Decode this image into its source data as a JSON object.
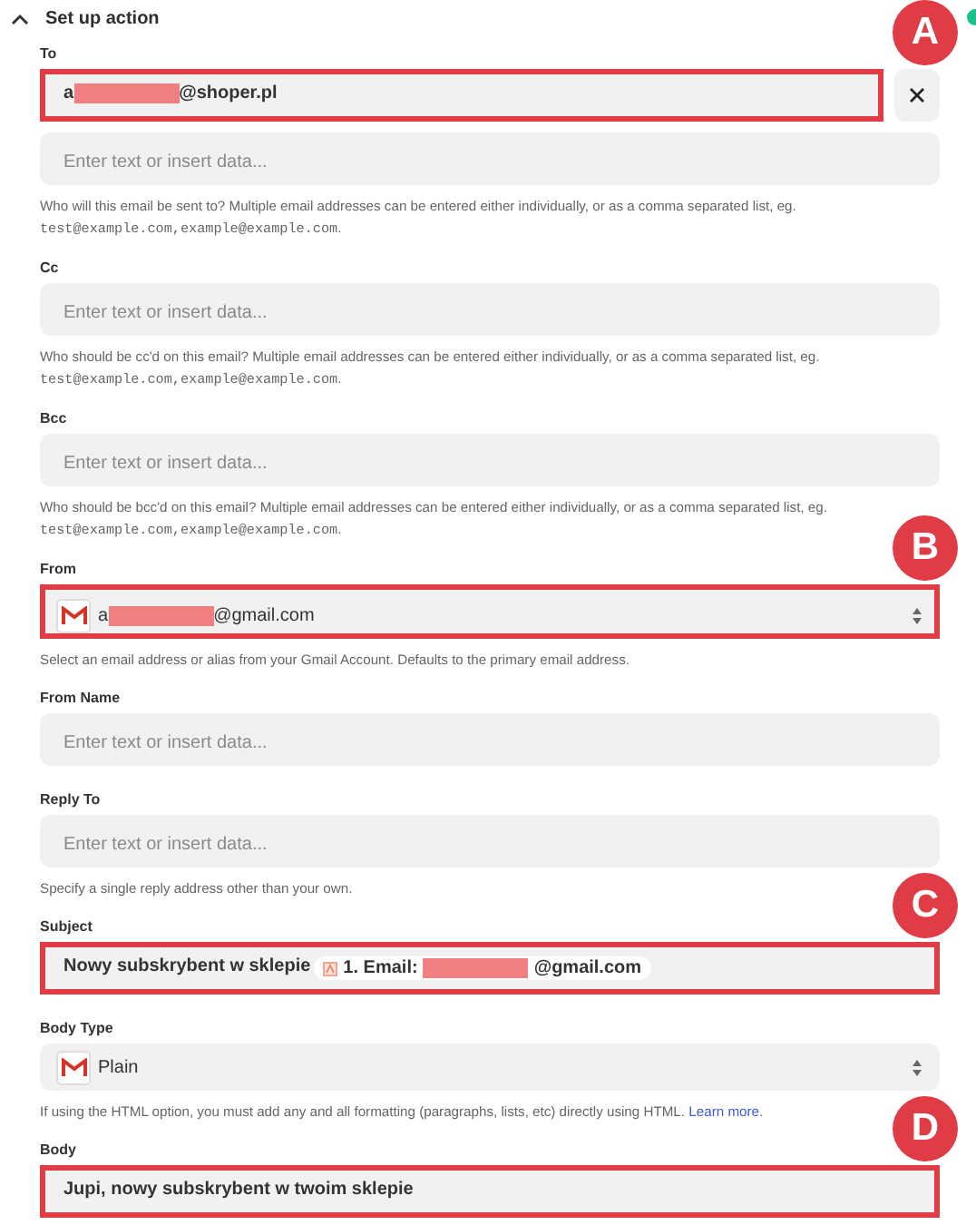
{
  "section": {
    "title": "Set up action",
    "expanded": true
  },
  "fields": [
    {
      "label": "To",
      "callout": "A",
      "inputs": [
        {
          "kind": "text",
          "highlighted": true,
          "removable": true,
          "parts": [
            {
              "kind": "text",
              "text": "a"
            },
            {
              "kind": "redacted"
            },
            {
              "kind": "text",
              "text": "@shoper.pl"
            }
          ]
        },
        {
          "kind": "text",
          "highlighted": false,
          "removable": false,
          "placeholder": "Enter text or insert data..."
        }
      ],
      "help": {
        "text": "Who will this email be sent to? Multiple email addresses can be entered either individually, or as a comma separated list, eg.",
        "code": "test@example.com,example@example.com",
        "end": "."
      }
    },
    {
      "label": "Cc",
      "inputs": [
        {
          "kind": "text",
          "highlighted": false,
          "removable": false,
          "placeholder": "Enter text or insert data..."
        }
      ],
      "help": {
        "text": "Who should be cc'd on this email? Multiple email addresses can be entered either individually, or as a comma separated list, eg.",
        "code": "test@example.com,example@example.com",
        "end": "."
      }
    },
    {
      "label": "Bcc",
      "inputs": [
        {
          "kind": "text",
          "highlighted": false,
          "removable": false,
          "placeholder": "Enter text or insert data..."
        }
      ],
      "help": {
        "text": "Who should be bcc'd on this email? Multiple email addresses can be entered either individually, or as a comma separated list, eg.",
        "code": "test@example.com,example@example.com",
        "end": "."
      }
    },
    {
      "label": "From",
      "callout": "B",
      "inputs": [
        {
          "kind": "select",
          "highlighted": true,
          "parts": [
            {
              "kind": "text",
              "text": "a"
            },
            {
              "kind": "redacted"
            },
            {
              "kind": "text",
              "text": "@gmail.com"
            }
          ]
        }
      ],
      "help": {
        "text": "Select an email address or alias from your Gmail Account. Defaults to the primary email address."
      }
    },
    {
      "label": "From Name",
      "inputs": [
        {
          "kind": "text",
          "highlighted": false,
          "removable": false,
          "placeholder": "Enter text or insert data..."
        }
      ]
    },
    {
      "label": "Reply To",
      "inputs": [
        {
          "kind": "text",
          "highlighted": false,
          "removable": false,
          "placeholder": "Enter text or insert data..."
        }
      ],
      "help": {
        "text": "Specify a single reply address other than your own."
      }
    },
    {
      "label": "Subject",
      "callout": "C",
      "inputs": [
        {
          "kind": "text",
          "highlighted": true,
          "removable": false,
          "parts": [
            {
              "kind": "text",
              "text": "Nowy subskrybent w sklepie"
            },
            {
              "kind": "token",
              "label": "1. Email:",
              "parts": [
                {
                  "kind": "redacted"
                },
                {
                  "kind": "text",
                  "text": "@gmail.com"
                }
              ]
            }
          ]
        }
      ]
    },
    {
      "label": "Body Type",
      "inputs": [
        {
          "kind": "select",
          "highlighted": false,
          "parts": [
            {
              "kind": "text",
              "text": "Plain"
            }
          ]
        }
      ],
      "help": {
        "text": "If using the HTML option, you must add any and all formatting (paragraphs, lists, etc) directly using HTML.",
        "link": "Learn more."
      }
    },
    {
      "label": "Body",
      "callout": "D",
      "inputs": [
        {
          "kind": "text",
          "highlighted": true,
          "removable": false,
          "parts": [
            {
              "kind": "text",
              "text": "Jupi, nowy subskrybent w twoim sklepie"
            }
          ]
        }
      ]
    }
  ]
}
